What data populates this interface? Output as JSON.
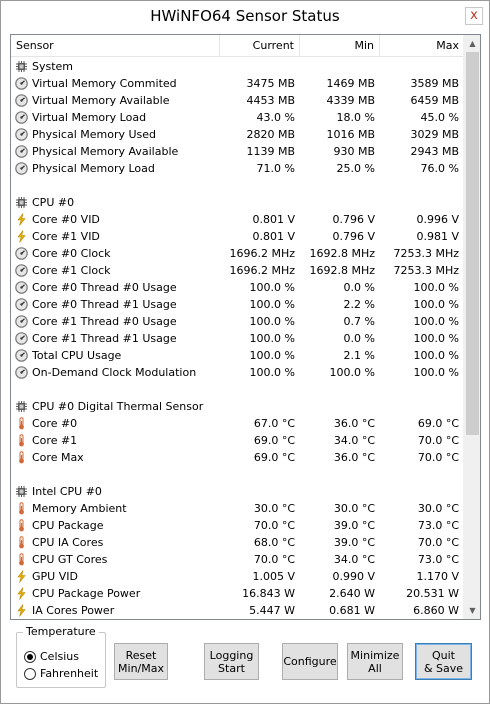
{
  "window": {
    "title": "HWiNFO64 Sensor Status",
    "close_glyph": "x"
  },
  "columns": {
    "sensor": "Sensor",
    "current": "Current",
    "min": "Min",
    "max": "Max"
  },
  "rows": [
    {
      "type": "group",
      "icon": "chip",
      "name": "System"
    },
    {
      "type": "item",
      "icon": "gauge",
      "name": "Virtual Memory Commited",
      "current": "3475 MB",
      "min": "1469 MB",
      "max": "3589 MB"
    },
    {
      "type": "item",
      "icon": "gauge",
      "name": "Virtual Memory Available",
      "current": "4453 MB",
      "min": "4339 MB",
      "max": "6459 MB"
    },
    {
      "type": "item",
      "icon": "gauge",
      "name": "Virtual Memory Load",
      "current": "43.0 %",
      "min": "18.0 %",
      "max": "45.0 %"
    },
    {
      "type": "item",
      "icon": "gauge",
      "name": "Physical Memory Used",
      "current": "2820 MB",
      "min": "1016 MB",
      "max": "3029 MB"
    },
    {
      "type": "item",
      "icon": "gauge",
      "name": "Physical Memory Available",
      "current": "1139 MB",
      "min": "930 MB",
      "max": "2943 MB"
    },
    {
      "type": "item",
      "icon": "gauge",
      "name": "Physical Memory Load",
      "current": "71.0 %",
      "min": "25.0 %",
      "max": "76.0 %"
    },
    {
      "type": "blank"
    },
    {
      "type": "group",
      "icon": "chip",
      "name": "CPU #0"
    },
    {
      "type": "item",
      "icon": "bolt",
      "name": "Core #0 VID",
      "current": "0.801 V",
      "min": "0.796 V",
      "max": "0.996 V"
    },
    {
      "type": "item",
      "icon": "bolt",
      "name": "Core #1 VID",
      "current": "0.801 V",
      "min": "0.796 V",
      "max": "0.981 V"
    },
    {
      "type": "item",
      "icon": "gauge",
      "name": "Core #0 Clock",
      "current": "1696.2 MHz",
      "min": "1692.8 MHz",
      "max": "7253.3 MHz"
    },
    {
      "type": "item",
      "icon": "gauge",
      "name": "Core #1 Clock",
      "current": "1696.2 MHz",
      "min": "1692.8 MHz",
      "max": "7253.3 MHz"
    },
    {
      "type": "item",
      "icon": "gauge",
      "name": "Core #0 Thread #0 Usage",
      "current": "100.0 %",
      "min": "0.0 %",
      "max": "100.0 %"
    },
    {
      "type": "item",
      "icon": "gauge",
      "name": "Core #0 Thread #1 Usage",
      "current": "100.0 %",
      "min": "2.2 %",
      "max": "100.0 %"
    },
    {
      "type": "item",
      "icon": "gauge",
      "name": "Core #1 Thread #0 Usage",
      "current": "100.0 %",
      "min": "0.7 %",
      "max": "100.0 %"
    },
    {
      "type": "item",
      "icon": "gauge",
      "name": "Core #1 Thread #1 Usage",
      "current": "100.0 %",
      "min": "0.0 %",
      "max": "100.0 %"
    },
    {
      "type": "item",
      "icon": "gauge",
      "name": "Total CPU Usage",
      "current": "100.0 %",
      "min": "2.1 %",
      "max": "100.0 %"
    },
    {
      "type": "item",
      "icon": "gauge",
      "name": "On-Demand Clock Modulation",
      "current": "100.0 %",
      "min": "100.0 %",
      "max": "100.0 %"
    },
    {
      "type": "blank"
    },
    {
      "type": "group",
      "icon": "chip",
      "name": "CPU #0 Digital Thermal Sensor"
    },
    {
      "type": "item",
      "icon": "thermo",
      "name": "Core #0",
      "current": "67.0 °C",
      "min": "36.0 °C",
      "max": "69.0 °C"
    },
    {
      "type": "item",
      "icon": "thermo",
      "name": "Core #1",
      "current": "69.0 °C",
      "min": "34.0 °C",
      "max": "70.0 °C"
    },
    {
      "type": "item",
      "icon": "thermo",
      "name": "Core Max",
      "current": "69.0 °C",
      "min": "36.0 °C",
      "max": "70.0 °C"
    },
    {
      "type": "blank"
    },
    {
      "type": "group",
      "icon": "chip",
      "name": "Intel CPU #0"
    },
    {
      "type": "item",
      "icon": "thermo",
      "name": "Memory Ambient",
      "current": "30.0 °C",
      "min": "30.0 °C",
      "max": "30.0 °C"
    },
    {
      "type": "item",
      "icon": "thermo",
      "name": "CPU Package",
      "current": "70.0 °C",
      "min": "39.0 °C",
      "max": "73.0 °C"
    },
    {
      "type": "item",
      "icon": "thermo",
      "name": "CPU IA Cores",
      "current": "68.0 °C",
      "min": "39.0 °C",
      "max": "70.0 °C"
    },
    {
      "type": "item",
      "icon": "thermo",
      "name": "CPU GT Cores",
      "current": "70.0 °C",
      "min": "34.0 °C",
      "max": "73.0 °C"
    },
    {
      "type": "item",
      "icon": "bolt",
      "name": "GPU VID",
      "current": "1.005 V",
      "min": "0.990 V",
      "max": "1.170 V"
    },
    {
      "type": "item",
      "icon": "bolt",
      "name": "CPU Package Power",
      "current": "16.843 W",
      "min": "2.640 W",
      "max": "20.531 W"
    },
    {
      "type": "item",
      "icon": "bolt",
      "name": "IA Cores Power",
      "current": "5.447 W",
      "min": "0.681 W",
      "max": "6.860 W"
    }
  ],
  "temperature": {
    "title": "Temperature",
    "celsius": "Celsius",
    "fahrenheit": "Fahrenheit",
    "selected": "Celsius"
  },
  "buttons": {
    "reset": "Reset\nMin/Max",
    "logging": "Logging\nStart",
    "configure": "Configure",
    "minimize": "Minimize\nAll",
    "quit": "Quit\n& Save"
  },
  "colors": {
    "gauge": "#7a7a7a",
    "bolt": "#e8b200",
    "thermo": "#d06a3a",
    "chip": "#5a5a5a"
  }
}
